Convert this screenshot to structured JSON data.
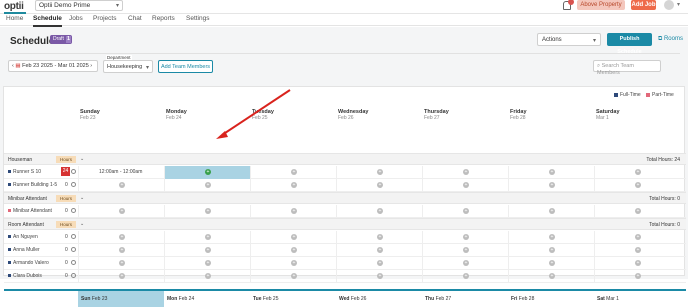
{
  "app": {
    "logo_text": "optii",
    "property": "Optii Demo Prime"
  },
  "topbar": {
    "above_property": "Above Property",
    "add_job": "Add Job"
  },
  "nav": {
    "tabs": [
      "Home",
      "Schedule",
      "Jobs",
      "Projects",
      "Chat",
      "Reports",
      "Settings"
    ],
    "active": "Schedule"
  },
  "page": {
    "title": "Schedule",
    "draft_label": "Draft",
    "draft_count": "1",
    "actions": "Actions",
    "publish": "Publish Schedule",
    "rooms": "Rooms"
  },
  "filters": {
    "date_range": "Feb 23 2025 - Mar 01 2025",
    "department_label": "Department",
    "department_value": "Housekeeping",
    "add_team": "Add Team Members",
    "search_placeholder": "Search Team Members"
  },
  "legend": {
    "full_time": "Full-Time",
    "part_time": "Part-Time",
    "full_time_color": "#2e4a7a",
    "part_time_color": "#e2687a"
  },
  "days": [
    {
      "name": "Sunday",
      "date": "Feb 23"
    },
    {
      "name": "Monday",
      "date": "Feb 24"
    },
    {
      "name": "Tuesday",
      "date": "Feb 25"
    },
    {
      "name": "Wednesday",
      "date": "Feb 26"
    },
    {
      "name": "Thursday",
      "date": "Feb 27"
    },
    {
      "name": "Friday",
      "date": "Feb 28"
    },
    {
      "name": "Saturday",
      "date": "Mar 1"
    }
  ],
  "groups": [
    {
      "name": "Houseman",
      "hours_label": "Hours",
      "total": "Total Hours: 24",
      "employees": [
        {
          "name": "Runner S 10",
          "hours": "24",
          "flag": true,
          "shift": "12:00am - 12:00am"
        },
        {
          "name": "Runner Building 1-5",
          "hours": "0"
        }
      ]
    },
    {
      "name": "Minibar Attendant",
      "hours_label": "Hours",
      "total": "Total Hours: 0",
      "employees": [
        {
          "name": "Minibar Attendant",
          "hours": "0",
          "part_time": true
        }
      ]
    },
    {
      "name": "Room Attendant",
      "hours_label": "Hours",
      "total": "Total Hours: 0",
      "employees": [
        {
          "name": "An Nguyen",
          "hours": "0"
        },
        {
          "name": "Anna Muller",
          "hours": "0"
        },
        {
          "name": "Armando Valero",
          "hours": "0"
        },
        {
          "name": "Clara Dubois",
          "hours": "0"
        }
      ]
    }
  ],
  "footer": [
    {
      "day": "Sun",
      "date": "Feb 23"
    },
    {
      "day": "Mon",
      "date": "Feb 24"
    },
    {
      "day": "Tue",
      "date": "Feb 25"
    },
    {
      "day": "Wed",
      "date": "Feb 26"
    },
    {
      "day": "Thu",
      "date": "Feb 27"
    },
    {
      "day": "Fri",
      "date": "Feb 28"
    },
    {
      "day": "Sat",
      "date": "Mar 1"
    }
  ]
}
